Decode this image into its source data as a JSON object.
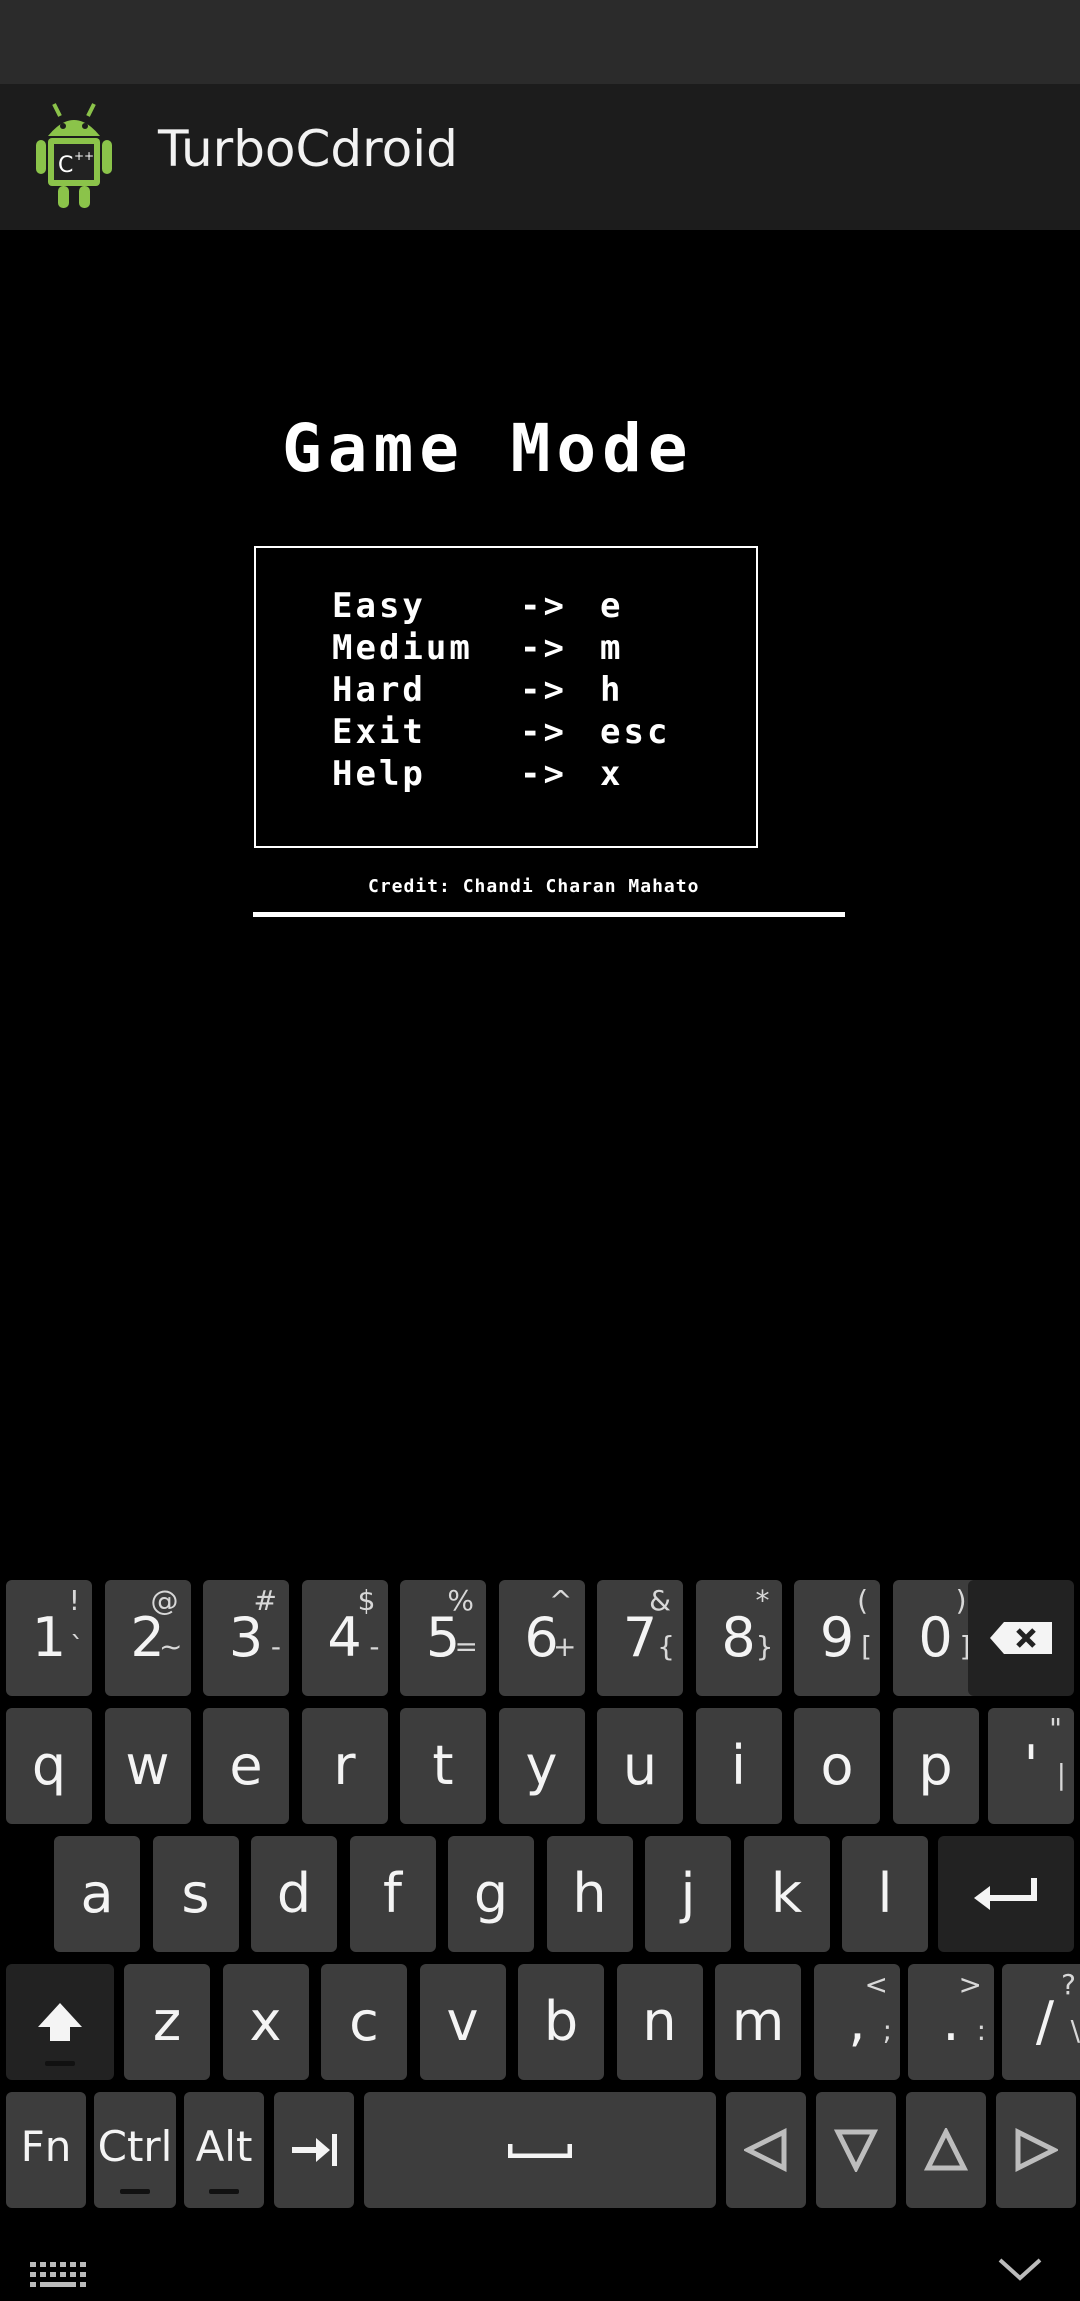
{
  "app": {
    "title": "TurboCdroid"
  },
  "game": {
    "title": "Game Mode",
    "menu": [
      {
        "label": "Easy",
        "arrow": "->",
        "key": "e"
      },
      {
        "label": "Medium",
        "arrow": "->",
        "key": "m"
      },
      {
        "label": "Hard",
        "arrow": "->",
        "key": "h"
      },
      {
        "label": "Exit",
        "arrow": "->",
        "key": "esc"
      },
      {
        "label": "Help",
        "arrow": "->",
        "key": "x"
      }
    ],
    "credit": "Credit: Chandi Charan Mahato"
  },
  "keyboard": {
    "row1": [
      {
        "main": "1",
        "sub_top": "!",
        "sub_bot": "`"
      },
      {
        "main": "2",
        "sub_top": "@",
        "sub_bot": "~"
      },
      {
        "main": "3",
        "sub_top": "#",
        "sub_bot": "-"
      },
      {
        "main": "4",
        "sub_top": "$",
        "sub_bot": "-"
      },
      {
        "main": "5",
        "sub_top": "%",
        "sub_bot": "="
      },
      {
        "main": "6",
        "sub_top": "^",
        "sub_bot": "+"
      },
      {
        "main": "7",
        "sub_top": "&",
        "sub_bot": "{"
      },
      {
        "main": "8",
        "sub_top": "*",
        "sub_bot": "}"
      },
      {
        "main": "9",
        "sub_top": "(",
        "sub_bot": "["
      },
      {
        "main": "0",
        "sub_top": ")",
        "sub_bot": "]"
      }
    ],
    "row2": [
      "q",
      "w",
      "e",
      "r",
      "t",
      "y",
      "u",
      "i",
      "o",
      "p"
    ],
    "row2_extra": {
      "main": "'",
      "sub_top": "\"",
      "sub_bot": "|"
    },
    "row3": [
      "a",
      "s",
      "d",
      "f",
      "g",
      "h",
      "j",
      "k",
      "l"
    ],
    "row4": [
      "z",
      "x",
      "c",
      "v",
      "b",
      "n",
      "m"
    ],
    "row4_punct": [
      {
        "main": ",",
        "sub_top": "<",
        "sub_bot": ";"
      },
      {
        "main": ".",
        "sub_top": ">",
        "sub_bot": ":"
      },
      {
        "main": "/",
        "sub_top": "?",
        "sub_bot": "\\"
      }
    ],
    "row5": {
      "fn": "Fn",
      "ctrl": "Ctrl",
      "alt": "Alt"
    },
    "icons": {
      "backspace": "backspace-icon",
      "enter": "enter-icon",
      "shift": "shift-icon",
      "tab": "tab-icon",
      "space": "space-icon",
      "left": "arrow-left-icon",
      "down": "arrow-down-icon",
      "up": "arrow-up-icon",
      "right": "arrow-right-icon",
      "keyboard": "keyboard-grid-icon",
      "hide": "chevron-down-icon"
    }
  }
}
